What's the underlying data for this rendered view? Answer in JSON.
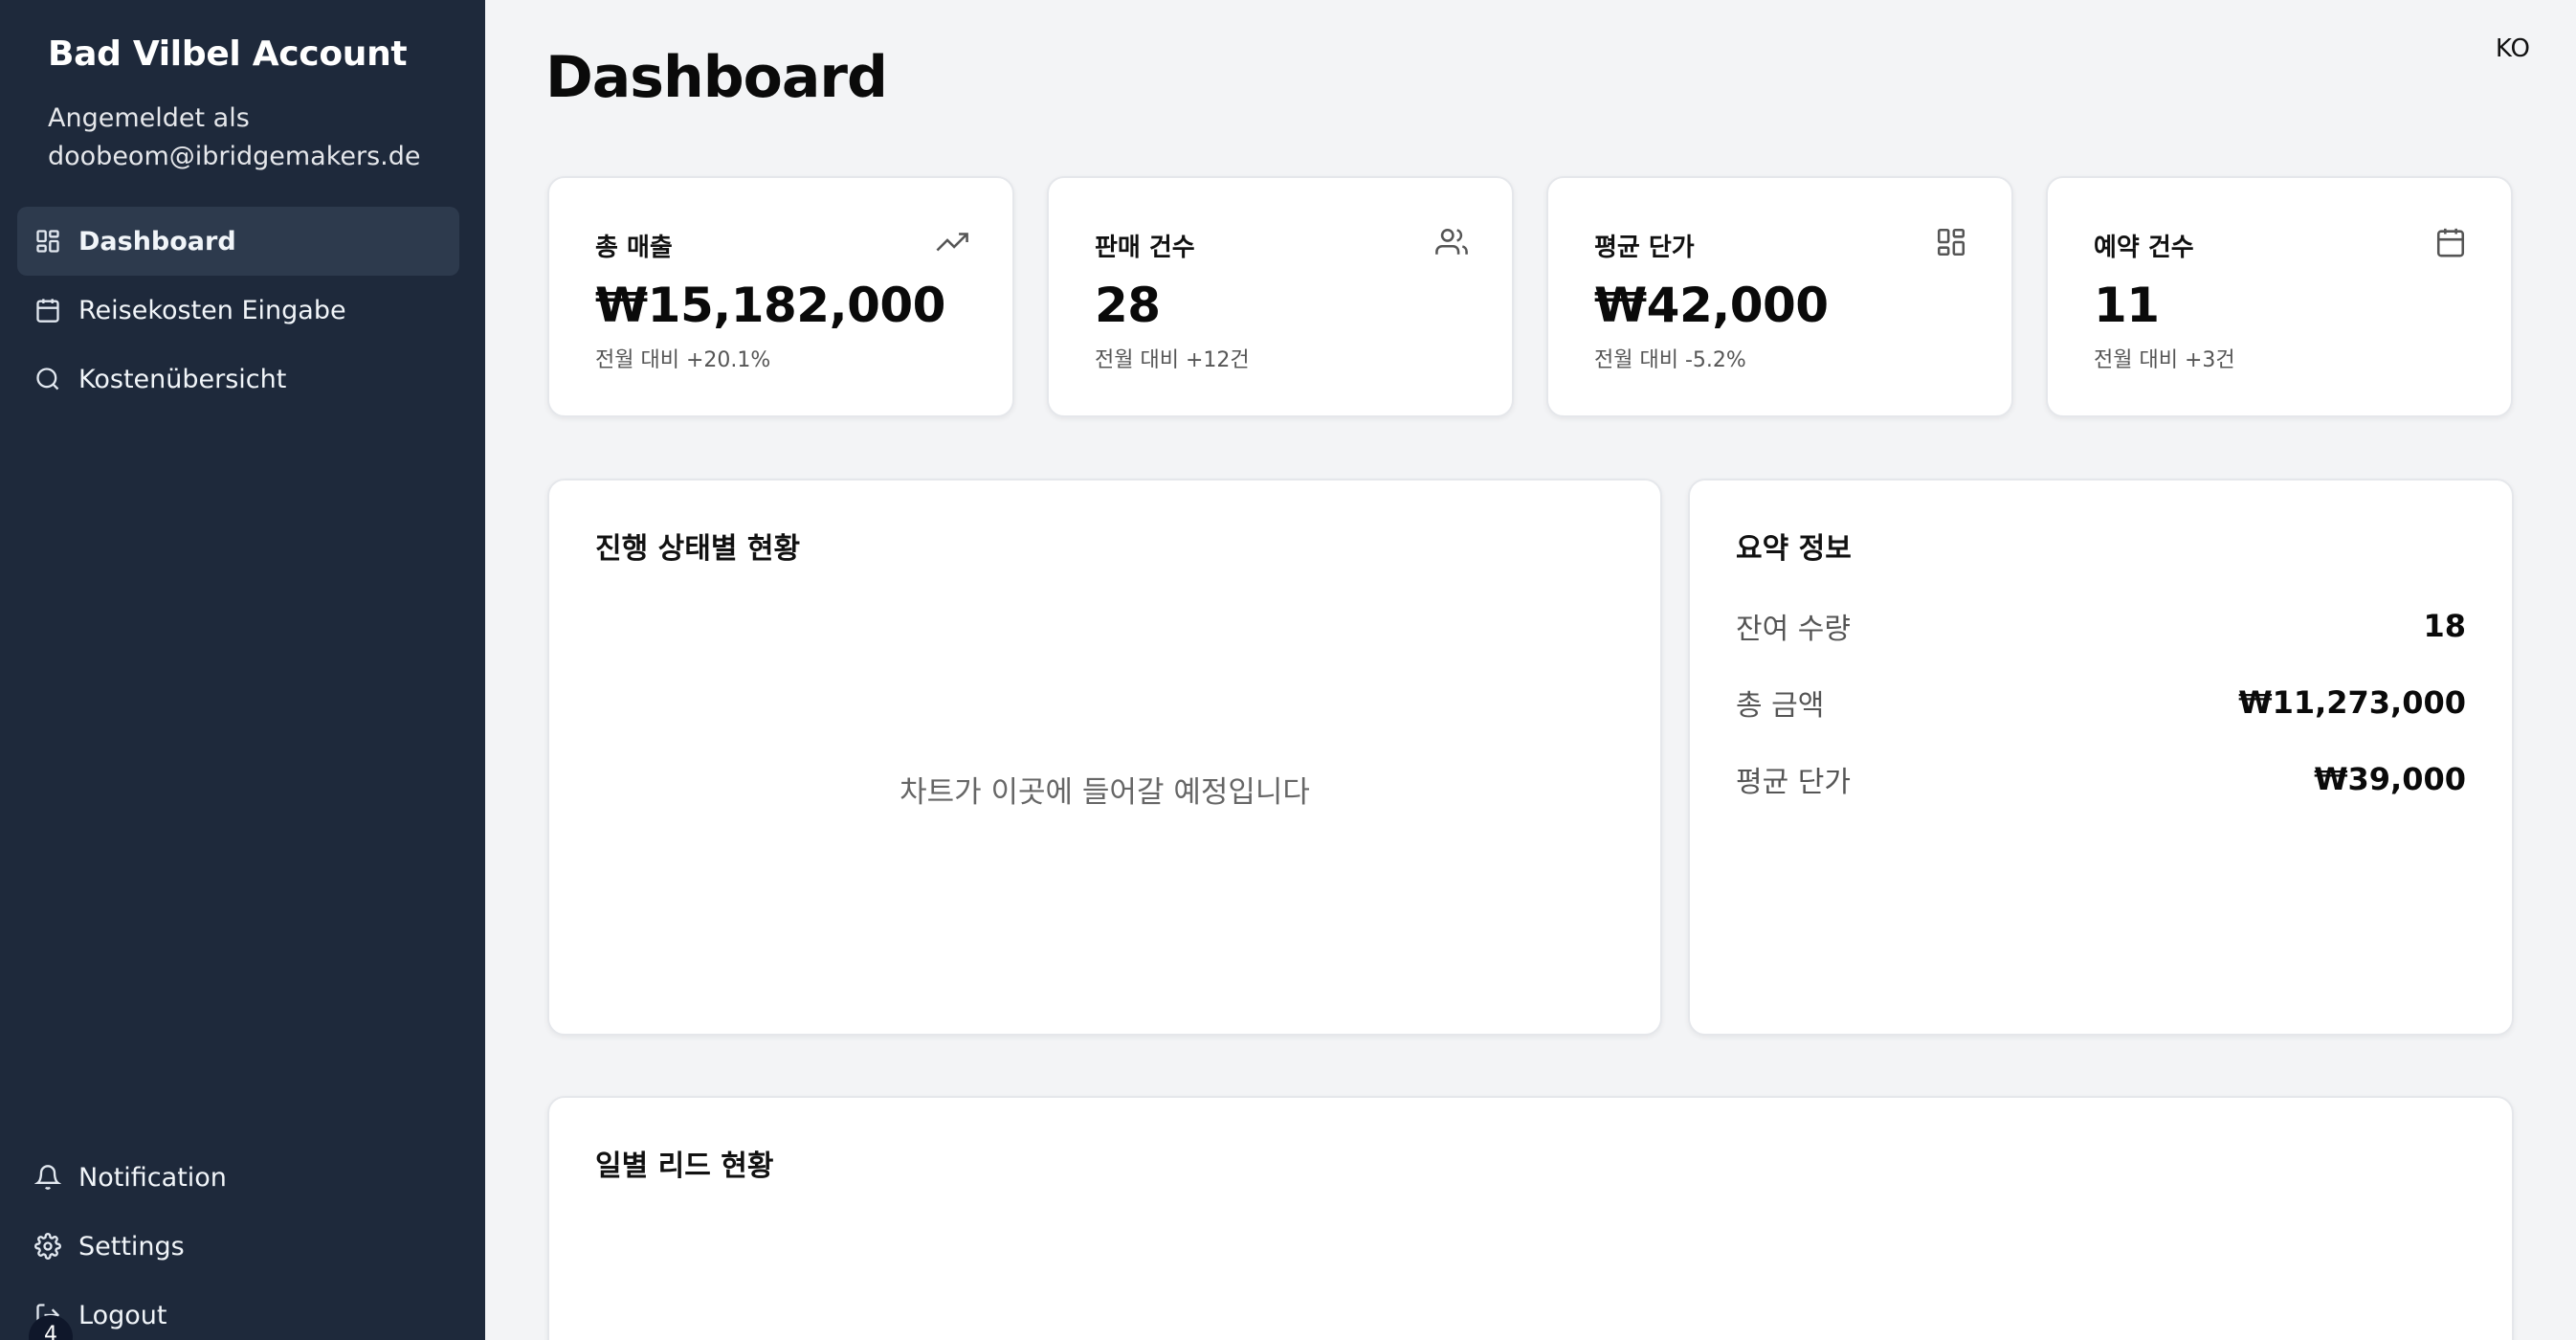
{
  "sidebar": {
    "brand": "Bad Vilbel Account",
    "login_prefix": "Angemeldet als",
    "login_email": "doobeom@ibridgemakers.de",
    "items": [
      {
        "label": "Dashboard",
        "icon": "dashboard-grid-icon",
        "active": true
      },
      {
        "label": "Reisekosten Eingabe",
        "icon": "calendar-icon",
        "active": false
      },
      {
        "label": "Kostenübersicht",
        "icon": "search-icon",
        "active": false
      }
    ],
    "bottom_items": [
      {
        "label": "Notification",
        "icon": "bell-icon"
      },
      {
        "label": "Settings",
        "icon": "gear-icon"
      },
      {
        "label": "Logout",
        "icon": "logout-icon"
      }
    ],
    "badge": "4"
  },
  "header": {
    "title": "Dashboard",
    "language": "KO"
  },
  "stats": [
    {
      "label": "총 매출",
      "value": "₩15,182,000",
      "sub": "전월 대비 +20.1%",
      "icon": "trending-up-icon"
    },
    {
      "label": "판매 건수",
      "value": "28",
      "sub": "전월 대비 +12건",
      "icon": "users-icon"
    },
    {
      "label": "평균 단가",
      "value": "₩42,000",
      "sub": "전월 대비 -5.2%",
      "icon": "grid-icon"
    },
    {
      "label": "예약 건수",
      "value": "11",
      "sub": "전월 대비 +3건",
      "icon": "calendar-icon"
    }
  ],
  "status_panel": {
    "title": "진행 상태별 현황",
    "placeholder": "차트가 이곳에 들어갈 예정입니다"
  },
  "summary_panel": {
    "title": "요약 정보",
    "rows": [
      {
        "key": "잔여 수량",
        "value": "18"
      },
      {
        "key": "총 금액",
        "value": "₩11,273,000"
      },
      {
        "key": "평균 단가",
        "value": "₩39,000"
      }
    ]
  },
  "daily_panel": {
    "title": "일별 리드 현황"
  },
  "colors": {
    "sidebar_bg": "#1e293b",
    "sidebar_active": "#2d3a4d",
    "page_bg": "#f3f4f6",
    "card_bg": "#ffffff"
  }
}
